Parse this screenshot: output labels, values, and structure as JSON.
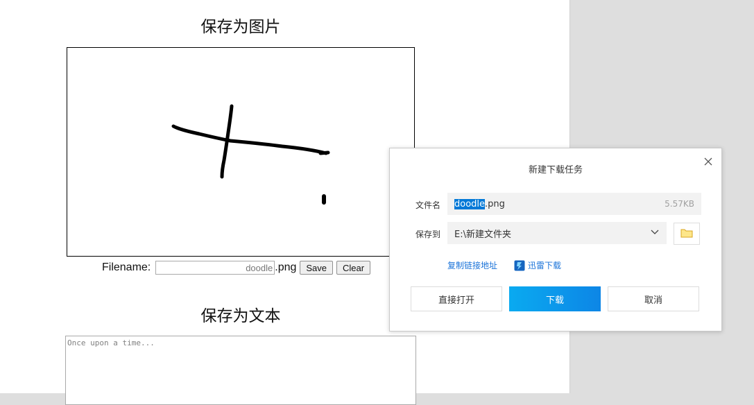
{
  "page": {
    "image_section_title": "保存为图片",
    "filename_label": "Filename:",
    "filename_placeholder": "doodle",
    "filename_ext": ".png",
    "save_label": "Save",
    "clear_label": "Clear",
    "text_section_title": "保存为文本",
    "text_placeholder": "Once upon a time..."
  },
  "dialog": {
    "title": "新建下载任务",
    "filename_label": "文件名",
    "filename_selected": "doodle",
    "filename_rest": ".png",
    "file_size": "5.57KB",
    "save_to_label": "保存到",
    "save_path": "E:\\新建文件夹",
    "copy_link_label": "复制链接地址",
    "thunder_label": "迅雷下载",
    "open_label": "直接打开",
    "download_label": "下载",
    "cancel_label": "取消",
    "accent_color": "#0d86e6",
    "selection_color": "#0078d7"
  },
  "icons": {
    "close": "close-icon",
    "chevron": "chevron-down-icon",
    "folder": "folder-icon",
    "thunder": "thunder-icon"
  }
}
